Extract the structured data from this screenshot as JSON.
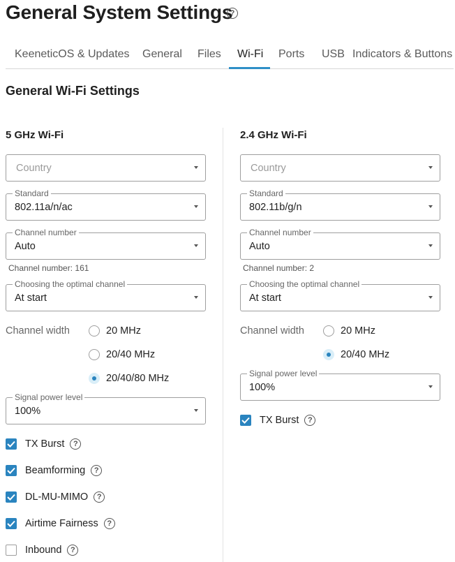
{
  "page": {
    "title": "General System Settings"
  },
  "tabs": [
    {
      "label": "KeeneticOS & Updates",
      "active": false
    },
    {
      "label": "General",
      "active": false
    },
    {
      "label": "Files",
      "active": false
    },
    {
      "label": "Wi-Fi",
      "active": true
    },
    {
      "label": "Ports",
      "active": false
    },
    {
      "label": "USB",
      "active": false
    },
    {
      "label": "Indicators & Buttons",
      "active": false
    }
  ],
  "section": {
    "title": "General Wi-Fi Settings"
  },
  "colors": {
    "accent": "#2a84bf",
    "tab_underline": "#2f8fc7"
  },
  "wifi5": {
    "title": "5 GHz Wi-Fi",
    "country": {
      "placeholder": "Country",
      "value": ""
    },
    "standard": {
      "label": "Standard",
      "value": "802.11a/n/ac"
    },
    "channel": {
      "label": "Channel number",
      "value": "Auto",
      "hint": "Channel number: 161"
    },
    "optimal": {
      "label": "Choosing the optimal channel",
      "value": "At start"
    },
    "width": {
      "label": "Channel width",
      "options": [
        {
          "label": "20 MHz",
          "checked": false
        },
        {
          "label": "20/40 MHz",
          "checked": false
        },
        {
          "label": "20/40/80 MHz",
          "checked": true
        }
      ]
    },
    "power": {
      "label": "Signal power level",
      "value": "100%"
    },
    "checkboxes": [
      {
        "label": "TX Burst",
        "checked": true
      },
      {
        "label": "Beamforming",
        "checked": true
      },
      {
        "label": "DL-MU-MIMO",
        "checked": true
      },
      {
        "label": "Airtime Fairness",
        "checked": true
      },
      {
        "label": "Inbound",
        "checked": false
      }
    ]
  },
  "wifi24": {
    "title": "2.4 GHz Wi-Fi",
    "country": {
      "placeholder": "Country",
      "value": ""
    },
    "standard": {
      "label": "Standard",
      "value": "802.11b/g/n"
    },
    "channel": {
      "label": "Channel number",
      "value": "Auto",
      "hint": "Channel number: 2"
    },
    "optimal": {
      "label": "Choosing the optimal channel",
      "value": "At start"
    },
    "width": {
      "label": "Channel width",
      "options": [
        {
          "label": "20 MHz",
          "checked": false
        },
        {
          "label": "20/40 MHz",
          "checked": true
        }
      ]
    },
    "power": {
      "label": "Signal power level",
      "value": "100%"
    },
    "checkboxes": [
      {
        "label": "TX Burst",
        "checked": true
      }
    ]
  }
}
